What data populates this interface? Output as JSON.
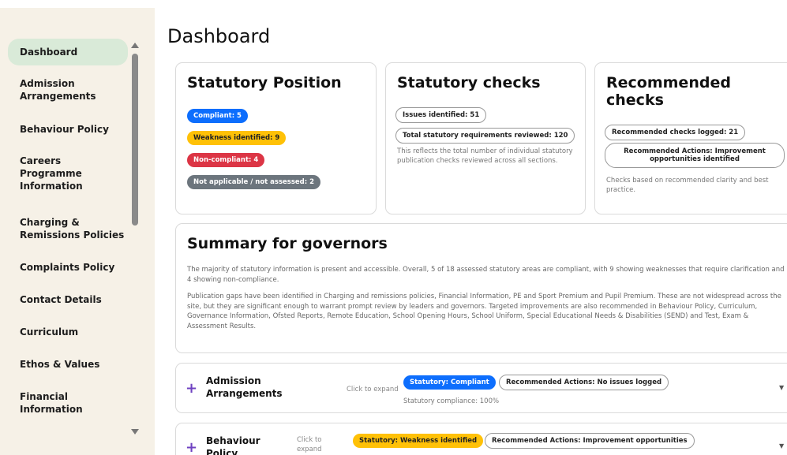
{
  "sidebar": {
    "items": [
      {
        "label": "Dashboard",
        "active": true
      },
      {
        "label": "Admission Arrangements"
      },
      {
        "label": "Behaviour Policy"
      },
      {
        "label": "Careers Programme Information"
      },
      {
        "label": "Charging & Remissions Policies"
      },
      {
        "label": "Complaints Policy"
      },
      {
        "label": "Contact Details"
      },
      {
        "label": "Curriculum"
      },
      {
        "label": "Ethos & Values"
      },
      {
        "label": "Financial Information"
      }
    ]
  },
  "page": {
    "title": "Dashboard"
  },
  "statutory_position": {
    "title": "Statutory Position",
    "badges": [
      {
        "label": "Compliant: 5",
        "color": "#0d6efd"
      },
      {
        "label": "Weakness identified: 9",
        "color": "#ffc107"
      },
      {
        "label": "Non-compliant: 4",
        "color": "#dc3545"
      },
      {
        "label": "Not applicable / not assessed: 2",
        "color": "#6c757d"
      }
    ]
  },
  "statutory_checks": {
    "title": "Statutory checks",
    "issues": "Issues identified: 51",
    "total": "Total statutory requirements reviewed: 120",
    "note": "This reflects the total number of individual statutory publication checks reviewed across all sections."
  },
  "recommended_checks": {
    "title": "Recommended checks",
    "logged": "Recommended checks logged: 21",
    "actions": "Recommended Actions: Improvement opportunities identified",
    "note": "Checks based on recommended clarity and best practice."
  },
  "summary": {
    "title": "Summary for governors",
    "para1": "The majority of statutory information is present and accessible. Overall, 5 of 18 assessed statutory areas are compliant, with 9 showing weaknesses that require clarification and 4 showing non-compliance.",
    "para2": "Publication gaps have been identified in Charging and remissions policies, Financial Information, PE and Sport Premium and Pupil Premium. These are not widespread across the site, but they are significant enough to warrant prompt review by leaders and governors. Targeted improvements are also recommended in Behaviour Policy, Curriculum, Governance Information, Ofsted Reports, Remote Education, School Opening Hours, School Uniform, Special Educational Needs & Disabilities (SEND) and Test, Exam & Assessment Results."
  },
  "sections": [
    {
      "title": "Admission Arrangements",
      "expand": "Click to expand",
      "statutory": "Statutory: Compliant",
      "recommended": "Recommended Actions: No issues logged",
      "compliance": "Statutory compliance: 100%"
    },
    {
      "title": "Behaviour Policy",
      "expand": "Click to expand",
      "statutory": "Statutory: Weakness identified",
      "recommended": "Recommended Actions: Improvement opportunities"
    }
  ],
  "icons": {
    "expand": "plus-icon",
    "chevron": "chevron-down-icon"
  }
}
